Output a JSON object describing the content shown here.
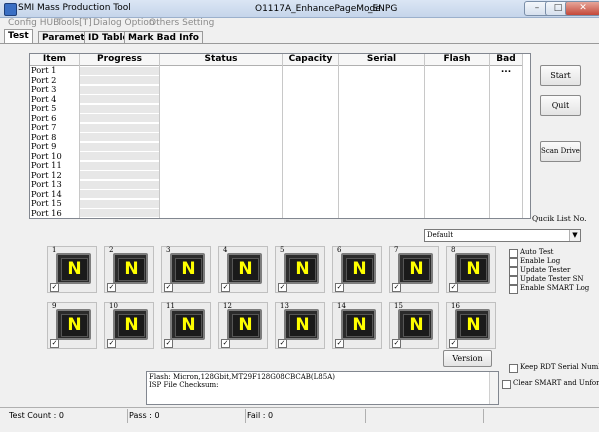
{
  "window": {
    "title": "SMI Mass Production Tool",
    "doc_title": "O1117A_EnhancePageMode",
    "doc_suffix": "_ENPG",
    "controls": {
      "minimize": "–",
      "maximize": "□",
      "close": "✕"
    }
  },
  "menu": [
    "Config HUB",
    "Tools[T]",
    "Dialog Option",
    "Others Setting"
  ],
  "tabs": [
    "Test",
    "Parameter",
    "ID Table",
    "Mark Bad Info"
  ],
  "table": {
    "columns": [
      "Item",
      "Progress",
      "Status",
      "Capacity",
      "Serial",
      "Flash",
      "Bad ..."
    ],
    "rows": [
      "Port 1",
      "Port 2",
      "Port 3",
      "Port 4",
      "Port 5",
      "Port 6",
      "Port 7",
      "Port 8",
      "Port 9",
      "Port 10",
      "Port 11",
      "Port 12",
      "Port 13",
      "Port 14",
      "Port 15",
      "Port 16"
    ]
  },
  "buttons": {
    "start": "Start",
    "quit": "Quit",
    "scan": "Scan Drive",
    "version": "Version"
  },
  "quick_list": {
    "label": "Qucik List No.",
    "value": "Default"
  },
  "drives": [
    {
      "num": "1",
      "letter": "N"
    },
    {
      "num": "2",
      "letter": "N"
    },
    {
      "num": "3",
      "letter": "N"
    },
    {
      "num": "4",
      "letter": "N"
    },
    {
      "num": "5",
      "letter": "N"
    },
    {
      "num": "6",
      "letter": "N"
    },
    {
      "num": "7",
      "letter": "N"
    },
    {
      "num": "8",
      "letter": "N"
    },
    {
      "num": "9",
      "letter": "N"
    },
    {
      "num": "10",
      "letter": "N"
    },
    {
      "num": "11",
      "letter": "N"
    },
    {
      "num": "12",
      "letter": "N"
    },
    {
      "num": "13",
      "letter": "N"
    },
    {
      "num": "14",
      "letter": "N"
    },
    {
      "num": "15",
      "letter": "N"
    },
    {
      "num": "16",
      "letter": "N"
    }
  ],
  "options": [
    "Auto Test",
    "Enable Log",
    "Update Tester",
    "Update Tester SN",
    "Enable SMART Log"
  ],
  "keep_rdt": "Keep RDT Serial Number",
  "clear_smart": "Clear SMART and Unformat",
  "log_lines": [
    "Flash: Micron,128Gbit,MT29F128G08CBCAB(L85A)",
    "ISP File Checksum:"
  ],
  "status": {
    "count": "Test Count : 0",
    "pass": "Pass : 0",
    "fail": "Fail : 0"
  },
  "colors": {
    "drive_letter": "#ffff00",
    "progress_cell": "#e7e7e7"
  }
}
